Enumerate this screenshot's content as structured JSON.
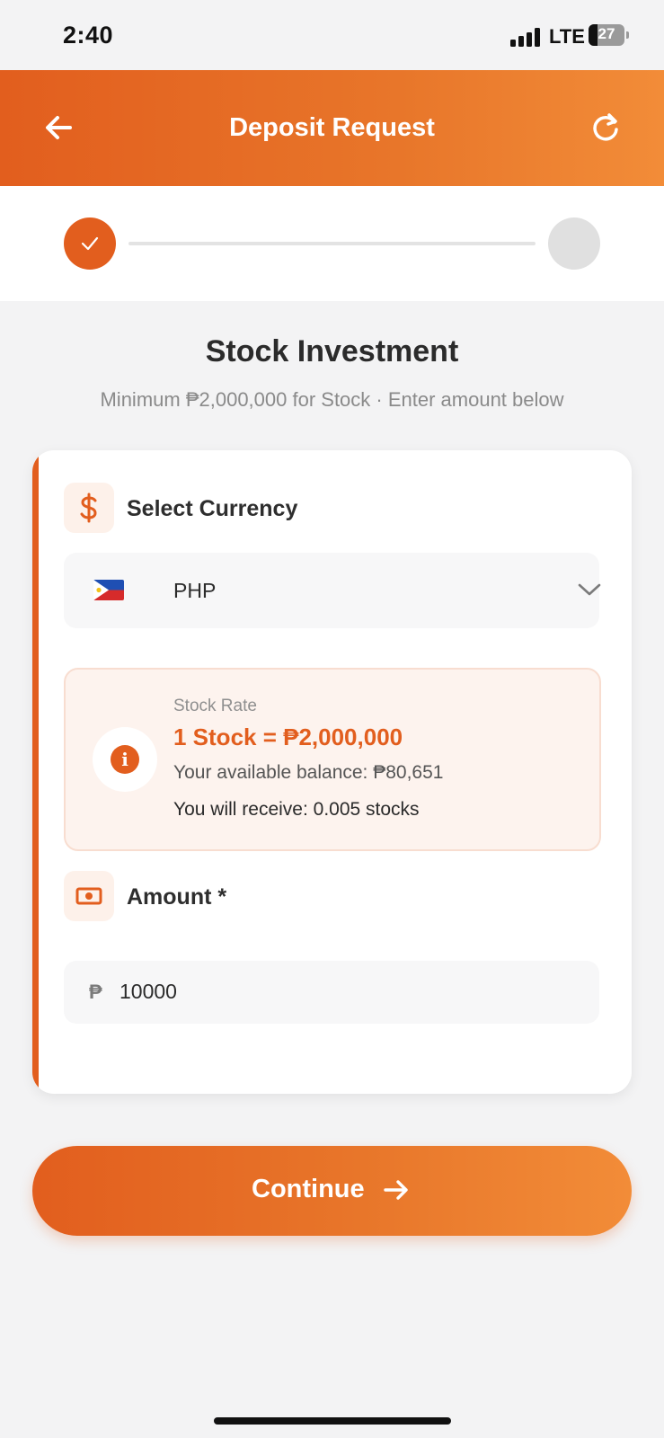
{
  "status_bar": {
    "time": "2:40",
    "network": "LTE",
    "battery": "27"
  },
  "header": {
    "title": "Deposit Request",
    "back_icon": "arrow-left-icon",
    "refresh_icon": "refresh-icon"
  },
  "steps": {
    "current": 1,
    "total": 2
  },
  "page": {
    "title": "Stock Investment",
    "subtitle": "Minimum ₱2,000,000 for Stock · Enter amount below"
  },
  "currency": {
    "label": "Select Currency",
    "icon": "dollar-icon",
    "selected": "PHP",
    "flag": "philippines-flag"
  },
  "rate_box": {
    "label": "Stock Rate",
    "rate": "1 Stock = ₱2,000,000",
    "balance": "Your available balance: ₱80,651",
    "receive": "You will receive: 0.005 stocks"
  },
  "amount": {
    "label": "Amount *",
    "icon": "cash-icon",
    "currency_symbol": "₱",
    "value": "10000"
  },
  "continue_button": {
    "label": "Continue"
  },
  "colors": {
    "accent": "#e25e1e",
    "accent_light": "#f28c38",
    "background": "#f3f3f4"
  }
}
